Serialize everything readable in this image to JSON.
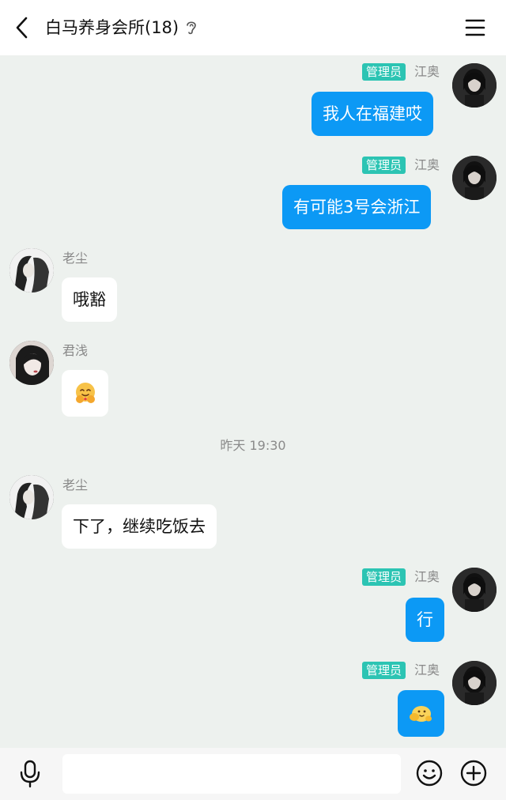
{
  "header": {
    "title": "白马养身会所(18)"
  },
  "messages": [
    {
      "side": "right",
      "badge": "管理员",
      "name": "江奥",
      "text": "我人在福建哎"
    },
    {
      "side": "right",
      "badge": "管理员",
      "name": "江奥",
      "text": "有可能3号会浙江"
    },
    {
      "side": "left",
      "name": "老尘",
      "text": "哦豁"
    },
    {
      "side": "left",
      "name": "君浅",
      "emoji": "hugging-face-emoji"
    },
    {
      "timestamp": "昨天 19:30"
    },
    {
      "side": "left",
      "name": "老尘",
      "text": "下了，继续吃饭去"
    },
    {
      "side": "right",
      "badge": "管理员",
      "name": "江奥",
      "text": "行"
    },
    {
      "side": "right",
      "badge": "管理员",
      "name": "江奥",
      "emoji": "hug-sticker-emoji"
    }
  ],
  "colors": {
    "background": "#edf1ee",
    "my_bubble": "#0c99f5",
    "admin_badge": "#2cc4b3"
  },
  "icons": [
    "back-arrow-icon",
    "ear-icon",
    "menu-icon",
    "microphone-icon",
    "smiley-icon",
    "plus-circle-icon"
  ]
}
